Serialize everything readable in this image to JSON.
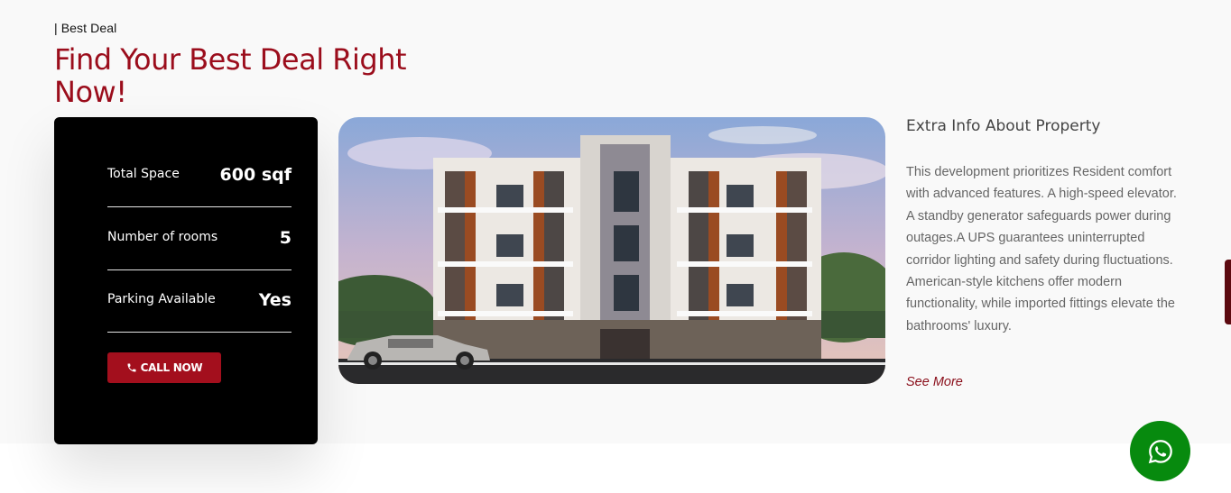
{
  "section": {
    "eyebrow": "| Best Deal",
    "heading_line1": "Find Your Best Deal Right",
    "heading_line2": "Now!"
  },
  "card": {
    "stats": [
      {
        "label": "Total Space",
        "value": "600 sqf"
      },
      {
        "label": "Number of rooms",
        "value": "5"
      },
      {
        "label": "Parking Available",
        "value": "Yes"
      }
    ],
    "call_label": "CALL NOW"
  },
  "extra": {
    "title": "Extra Info About Property",
    "description": "This development prioritizes Resident comfort with advanced features. A high-speed elevator. A standby generator safeguards power during outages.A UPS guarantees uninterrupted corridor lighting and safety during fluctuations. American-style kitchens offer modern functionality, while imported fittings elevate the bathrooms' luxury.",
    "see_more": "See More"
  },
  "icons": {
    "phone": "phone-icon",
    "whatsapp": "whatsapp-icon"
  },
  "colors": {
    "accent": "#9b0d1c",
    "button": "#a30f1d",
    "card_bg": "#000000",
    "whatsapp": "#078a0e",
    "see_more": "#8a0e1a"
  }
}
